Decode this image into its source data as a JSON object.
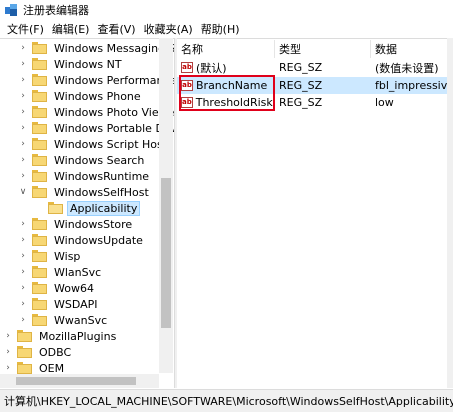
{
  "window": {
    "title": "注册表编辑器",
    "icon": "regedit-icon"
  },
  "menu": [
    "文件(F)",
    "编辑(E)",
    "查看(V)",
    "收藏夹(A)",
    "帮助(H)"
  ],
  "tree": {
    "items": [
      {
        "label": "Windows Messaging Su",
        "expander": ">",
        "level": 2
      },
      {
        "label": "Windows NT",
        "expander": ">",
        "level": 2
      },
      {
        "label": "Windows Performance T",
        "expander": ">",
        "level": 2
      },
      {
        "label": "Windows Phone",
        "expander": ">",
        "level": 2
      },
      {
        "label": "Windows Photo Viewer",
        "expander": ">",
        "level": 2
      },
      {
        "label": "Windows Portable Devi",
        "expander": ">",
        "level": 2
      },
      {
        "label": "Windows Script Host",
        "expander": ">",
        "level": 2
      },
      {
        "label": "Windows Search",
        "expander": ">",
        "level": 2
      },
      {
        "label": "WindowsRuntime",
        "expander": ">",
        "level": 2
      },
      {
        "label": "WindowsSelfHost",
        "expander": "v",
        "level": 2
      },
      {
        "label": "Applicability",
        "expander": "",
        "level": 3,
        "selected": true
      },
      {
        "label": "WindowsStore",
        "expander": ">",
        "level": 2
      },
      {
        "label": "WindowsUpdate",
        "expander": ">",
        "level": 2
      },
      {
        "label": "Wisp",
        "expander": ">",
        "level": 2
      },
      {
        "label": "WlanSvc",
        "expander": ">",
        "level": 2
      },
      {
        "label": "Wow64",
        "expander": ">",
        "level": 2
      },
      {
        "label": "WSDAPI",
        "expander": ">",
        "level": 2
      },
      {
        "label": "WwanSvc",
        "expander": ">",
        "level": 2
      },
      {
        "label": "MozillaPlugins",
        "expander": ">",
        "level": 1
      },
      {
        "label": "ODBC",
        "expander": ">",
        "level": 1
      },
      {
        "label": "OEM",
        "expander": ">",
        "level": 1
      }
    ]
  },
  "list": {
    "columns": [
      "名称",
      "类型",
      "数据"
    ],
    "rows": [
      {
        "name": "(默认)",
        "type": "REG_SZ",
        "data": "(数值未设置)"
      },
      {
        "name": "BranchName",
        "type": "REG_SZ",
        "data": "fbl_impressive",
        "selected": true
      },
      {
        "name": "ThresholdRisk...",
        "type": "REG_SZ",
        "data": "low"
      }
    ],
    "value_icon": "ab-icon"
  },
  "status": {
    "path": "计算机\\HKEY_LOCAL_MACHINE\\SOFTWARE\\Microsoft\\WindowsSelfHost\\Applicability"
  },
  "colors": {
    "selection": "#cce8ff",
    "highlight_box": "#e0001a",
    "folder": "#f7d774"
  }
}
